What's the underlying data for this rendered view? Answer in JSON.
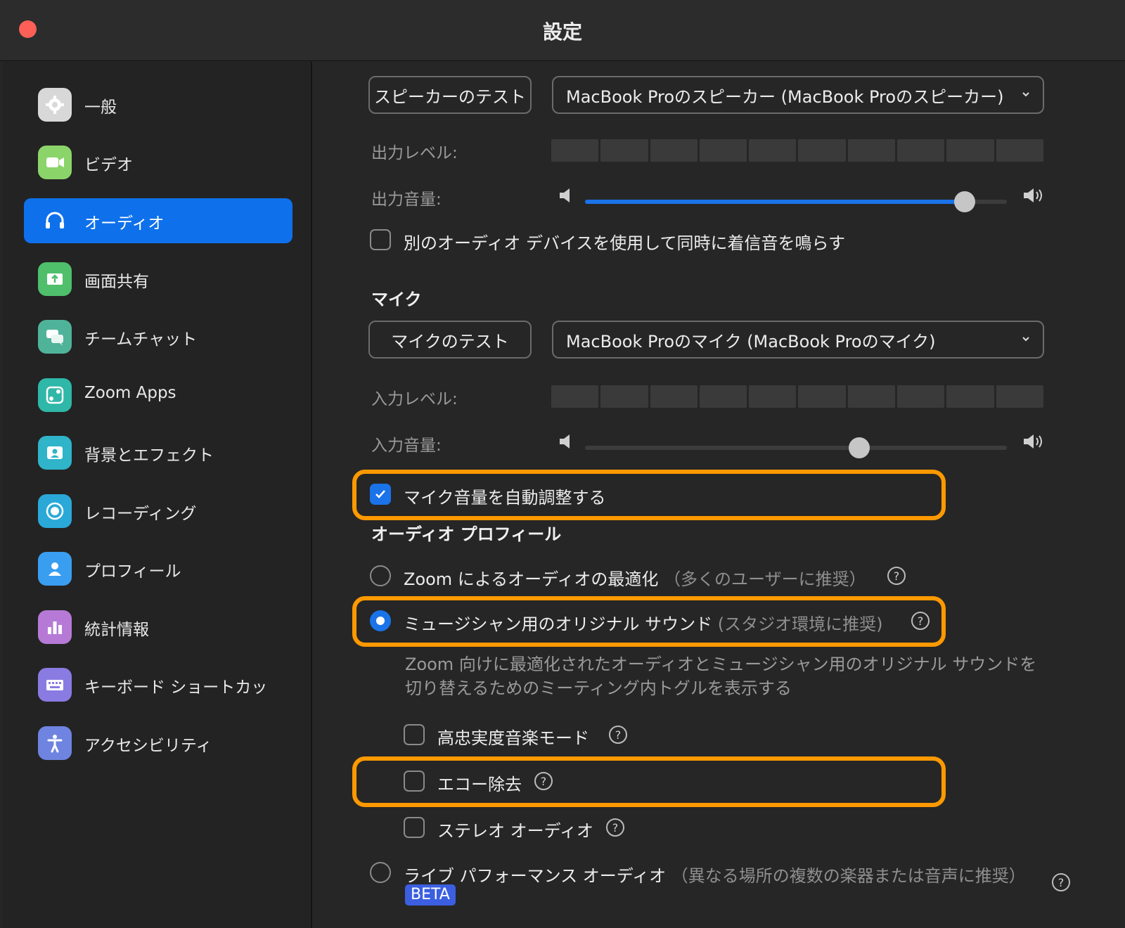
{
  "window": {
    "title": "設定"
  },
  "sidebar": {
    "items": [
      {
        "label": "一般",
        "icon": "gear-icon",
        "color": "#d8d8d8"
      },
      {
        "label": "ビデオ",
        "icon": "video-camera-icon",
        "color": "#8bd46a"
      },
      {
        "label": "オーディオ",
        "icon": "headphones-icon",
        "color": "#0e71eb"
      },
      {
        "label": "画面共有",
        "icon": "screen-share-icon",
        "color": "#4fbf6b"
      },
      {
        "label": "チームチャット",
        "icon": "chat-bubbles-icon",
        "color": "#4fb39a"
      },
      {
        "label": "Zoom Apps",
        "icon": "apps-icon",
        "color": "#2fb7a8"
      },
      {
        "label": "背景とエフェクト",
        "icon": "background-person-icon",
        "color": "#2fb4c9"
      },
      {
        "label": "レコーディング",
        "icon": "record-icon",
        "color": "#2aa9d8"
      },
      {
        "label": "プロフィール",
        "icon": "profile-icon",
        "color": "#3a9ef0"
      },
      {
        "label": "統計情報",
        "icon": "bar-chart-icon",
        "color": "#b67ad6"
      },
      {
        "label": "キーボード ショートカッ",
        "icon": "keyboard-icon",
        "color": "#8a7be3"
      },
      {
        "label": "アクセシビリティ",
        "icon": "accessibility-icon",
        "color": "#6f84e0"
      }
    ],
    "active_index": 2
  },
  "speaker": {
    "test_label": "スピーカーのテスト",
    "device": "MacBook Proのスピーカー (MacBook Proのスピーカー)",
    "output_level_label": "出力レベル:",
    "output_volume_label": "出力音量:",
    "output_volume": 0.9,
    "separate_ring_label": "別のオーディオ デバイスを使用して同時に着信音を鳴らす",
    "separate_ring_checked": false
  },
  "mic": {
    "section": "マイク",
    "test_label": "マイクのテスト",
    "device": "MacBook Proのマイク (MacBook Proのマイク)",
    "input_level_label": "入力レベル:",
    "input_volume_label": "入力音量:",
    "input_volume": 0.65,
    "auto_adjust_label": "マイク音量を自動調整する",
    "auto_adjust_checked": true
  },
  "profile": {
    "section": "オーディオ プロフィール",
    "opt1_label": "Zoom によるオーディオの最適化",
    "opt1_hint": "（多くのユーザーに推奨）",
    "opt2_label": "ミュージシャン用のオリジナル サウンド",
    "opt2_hint": "(スタジオ環境に推奨)",
    "opt2_desc": "Zoom 向けに最適化されたオーディオとミュージシャン用のオリジナル サウンドを切り替えるためのミーティング内トグルを表示する",
    "hifi_label": "高忠実度音楽モード",
    "echo_label": "エコー除去",
    "stereo_label": "ステレオ オーディオ",
    "opt3_label": "ライブ パフォーマンス オーディオ",
    "opt3_hint": "（異なる場所の複数の楽器または音声に推奨）",
    "beta": "BETA",
    "help_glyph": "?"
  },
  "colors": {
    "accent": "#1a73e8",
    "highlight": "#ff9900",
    "close": "#fe5f57"
  }
}
